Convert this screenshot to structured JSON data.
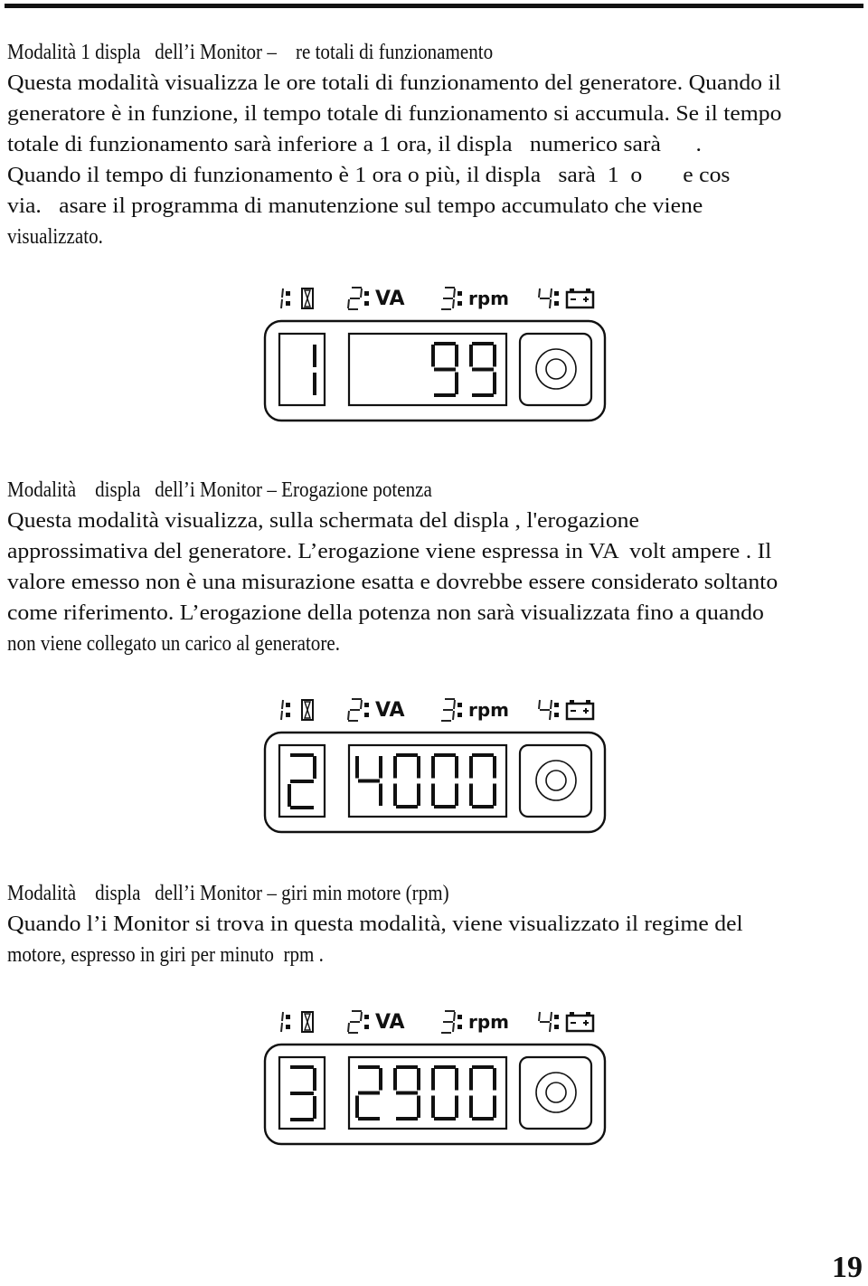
{
  "page": {
    "number": "19"
  },
  "sections": [
    {
      "heading": "Modalità 1 displa   dell’i Monitor –    re totali di funzionamento",
      "lines": [
        "Questa modalità visualizza le ore totali di funzionamento del generatore. Quando il",
        "generatore è in funzione, il tempo totale di funzionamento si accumula. Se il tempo",
        "totale di funzionamento sarà inferiore a 1 ora, il displa   numerico sarà      .",
        "Quando il tempo di funzionamento è 1 ora o più, il displa   sarà  1  o       e cos",
        "via.   asare il programma di manutenzione sul tempo accumulato che viene",
        "visualizzato."
      ],
      "display": {
        "labels": [
          {
            "num": "1:",
            "icon": "hourglass-icon"
          },
          {
            "num": "2:",
            "text": "VA"
          },
          {
            "num": "3:",
            "text": "rpm"
          },
          {
            "num": "4:",
            "icon": "battery-icon"
          }
        ],
        "mode_digit": "1",
        "value": "99"
      }
    },
    {
      "heading": "Modalità    displa   dell’i Monitor – Erogazione potenza",
      "lines": [
        "Questa modalità visualizza, sulla schermata del displa , l'erogazione",
        "approssimativa del generatore. L’erogazione viene espressa in VA  volt ampere . Il",
        "valore emesso non è una misurazione esatta e dovrebbe essere considerato soltanto",
        "come riferimento. L’erogazione della potenza non sarà visualizzata fino a quando",
        "non viene collegato un carico al generatore."
      ],
      "display": {
        "labels": [
          {
            "num": "1:",
            "icon": "hourglass-icon"
          },
          {
            "num": "2:",
            "text": "VA"
          },
          {
            "num": "3:",
            "text": "rpm"
          },
          {
            "num": "4:",
            "icon": "battery-icon"
          }
        ],
        "mode_digit": "2",
        "value": "4000"
      }
    },
    {
      "heading": "Modalità    displa   dell’i Monitor – giri min motore (rpm)",
      "lines": [
        "Quando l’i Monitor si trova in questa modalità, viene visualizzato il regime del",
        "motore, espresso in giri per minuto  rpm ."
      ],
      "display": {
        "labels": [
          {
            "num": "1:",
            "icon": "hourglass-icon"
          },
          {
            "num": "2:",
            "text": "VA"
          },
          {
            "num": "3:",
            "text": "rpm"
          },
          {
            "num": "4:",
            "icon": "battery-icon"
          }
        ],
        "mode_digit": "3",
        "value": "2900"
      }
    }
  ]
}
